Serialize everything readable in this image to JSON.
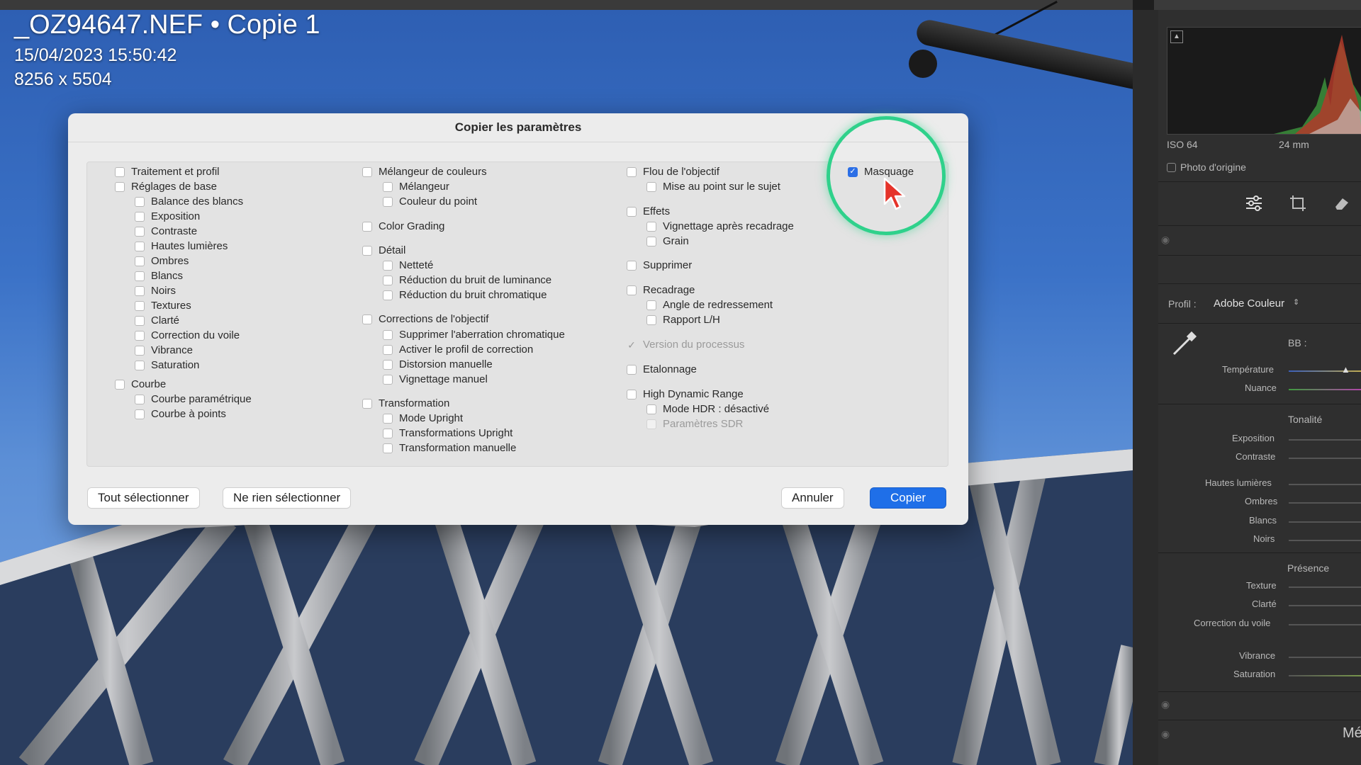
{
  "photo_info": {
    "filename": "_OZ94647.NEF  •  Copie 1",
    "datetime": "15/04/2023 15:50:42",
    "dimensions": "8256 x 5504"
  },
  "right_panel": {
    "iso": "ISO 64",
    "focal": "24 mm",
    "photo_origine": "Photo d'origine",
    "profil_label": "Profil :",
    "profil_value": "Adobe Couleur",
    "bb_label": "BB :",
    "temperature": "Température",
    "nuance": "Nuance",
    "tonalite": "Tonalité",
    "exposition": "Exposition",
    "contraste": "Contraste",
    "hautes_lumieres": "Hautes lumières",
    "ombres": "Ombres",
    "blancs": "Blancs",
    "noirs": "Noirs",
    "presence": "Présence",
    "texture": "Texture",
    "clarte": "Clarté",
    "correction_voile": "Correction du voile",
    "vibrance": "Vibrance",
    "saturation": "Saturation",
    "cut_label": "Mé"
  },
  "dialog": {
    "title": "Copier les paramètres",
    "col1": [
      {
        "label": "Traitement et profil",
        "checked": false
      },
      {
        "label": "Réglages de base",
        "checked": false
      },
      {
        "label": "Balance des blancs",
        "checked": false
      },
      {
        "label": "Exposition",
        "checked": false
      },
      {
        "label": "Contraste",
        "checked": false
      },
      {
        "label": "Hautes lumières",
        "checked": false
      },
      {
        "label": "Ombres",
        "checked": false
      },
      {
        "label": "Blancs",
        "checked": false
      },
      {
        "label": "Noirs",
        "checked": false
      },
      {
        "label": "Textures",
        "checked": false
      },
      {
        "label": "Clarté",
        "checked": false
      },
      {
        "label": "Correction du voile",
        "checked": false
      },
      {
        "label": "Vibrance",
        "checked": false
      },
      {
        "label": "Saturation",
        "checked": false
      },
      {
        "label": "Courbe",
        "checked": false
      },
      {
        "label": "Courbe paramétrique",
        "checked": false
      },
      {
        "label": "Courbe à points",
        "checked": false
      }
    ],
    "col2": [
      {
        "label": "Mélangeur de couleurs",
        "checked": false
      },
      {
        "label": "Mélangeur",
        "checked": false
      },
      {
        "label": "Couleur du point",
        "checked": false
      },
      {
        "label": "Color Grading",
        "checked": false
      },
      {
        "label": "Détail",
        "checked": false
      },
      {
        "label": "Netteté",
        "checked": false
      },
      {
        "label": "Réduction du bruit de luminance",
        "checked": false
      },
      {
        "label": "Réduction du bruit chromatique",
        "checked": false
      },
      {
        "label": "Corrections de l'objectif",
        "checked": false
      },
      {
        "label": "Supprimer l'aberration chromatique",
        "checked": false
      },
      {
        "label": "Activer le profil de correction",
        "checked": false
      },
      {
        "label": "Distorsion manuelle",
        "checked": false
      },
      {
        "label": "Vignettage manuel",
        "checked": false
      },
      {
        "label": "Transformation",
        "checked": false
      },
      {
        "label": "Mode Upright",
        "checked": false
      },
      {
        "label": "Transformations Upright",
        "checked": false
      },
      {
        "label": "Transformation manuelle",
        "checked": false
      }
    ],
    "col3": [
      {
        "label": "Flou de l'objectif",
        "checked": false
      },
      {
        "label": "Mise au point sur le sujet",
        "checked": false
      },
      {
        "label": "Effets",
        "checked": false
      },
      {
        "label": "Vignettage après recadrage",
        "checked": false
      },
      {
        "label": "Grain",
        "checked": false
      },
      {
        "label": "Supprimer",
        "checked": false
      },
      {
        "label": "Recadrage",
        "checked": false
      },
      {
        "label": "Angle de redressement",
        "checked": false
      },
      {
        "label": "Rapport L/H",
        "checked": false
      },
      {
        "label": "Version du processus",
        "checked": true,
        "disabled": true
      },
      {
        "label": "Etalonnage",
        "checked": false
      },
      {
        "label": "High Dynamic Range",
        "checked": false
      },
      {
        "label": "Mode HDR : désactivé",
        "checked": false
      },
      {
        "label": "Paramètres SDR",
        "checked": false,
        "disabled": true
      }
    ],
    "col4": [
      {
        "label": "Masquage",
        "checked": true
      }
    ],
    "buttons": {
      "select_all": "Tout sélectionner",
      "select_none": "Ne rien sélectionner",
      "cancel": "Annuler",
      "copy": "Copier"
    }
  },
  "colors": {
    "accent": "#1f6fe8",
    "highlight_ring": "#2fd18b",
    "cursor": "#e5332a"
  }
}
